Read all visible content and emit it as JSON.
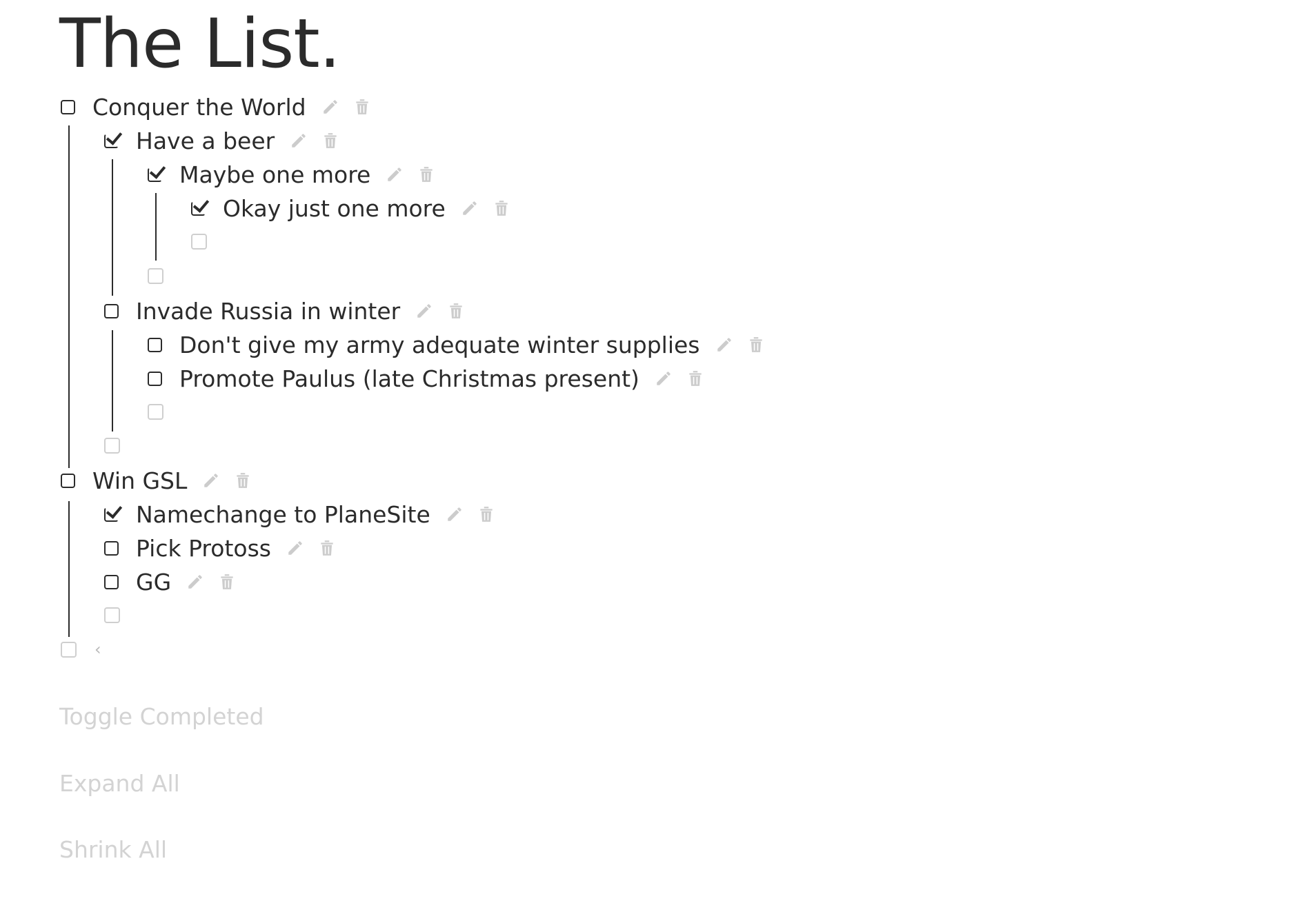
{
  "title": "The List.",
  "items": [
    {
      "text": "Conquer the World",
      "checked": false
    },
    {
      "text": "Have a beer",
      "checked": true
    },
    {
      "text": "Maybe one more",
      "checked": true
    },
    {
      "text": "Okay just one more",
      "checked": true
    },
    {
      "text": "Invade Russia in winter",
      "checked": false
    },
    {
      "text": "Don't give my army adequate winter supplies",
      "checked": false
    },
    {
      "text": "Promote Paulus (late Christmas present)",
      "checked": false
    },
    {
      "text": "Win GSL",
      "checked": false
    },
    {
      "text": "Namechange to PlaneSite",
      "checked": true
    },
    {
      "text": "Pick Protoss",
      "checked": false
    },
    {
      "text": "GG",
      "checked": false
    }
  ],
  "collapse_glyph": "‹",
  "footer": {
    "toggle_completed": "Toggle Completed",
    "expand_all": "Expand All",
    "shrink_all": "Shrink All"
  },
  "colors": {
    "text": "#2b2b2b",
    "icon": "#cccccc",
    "muted": "#d3d3d3",
    "empty_checkbox": "#cfcfcf"
  },
  "icons": {
    "edit": "pencil-icon",
    "delete": "trash-icon"
  }
}
